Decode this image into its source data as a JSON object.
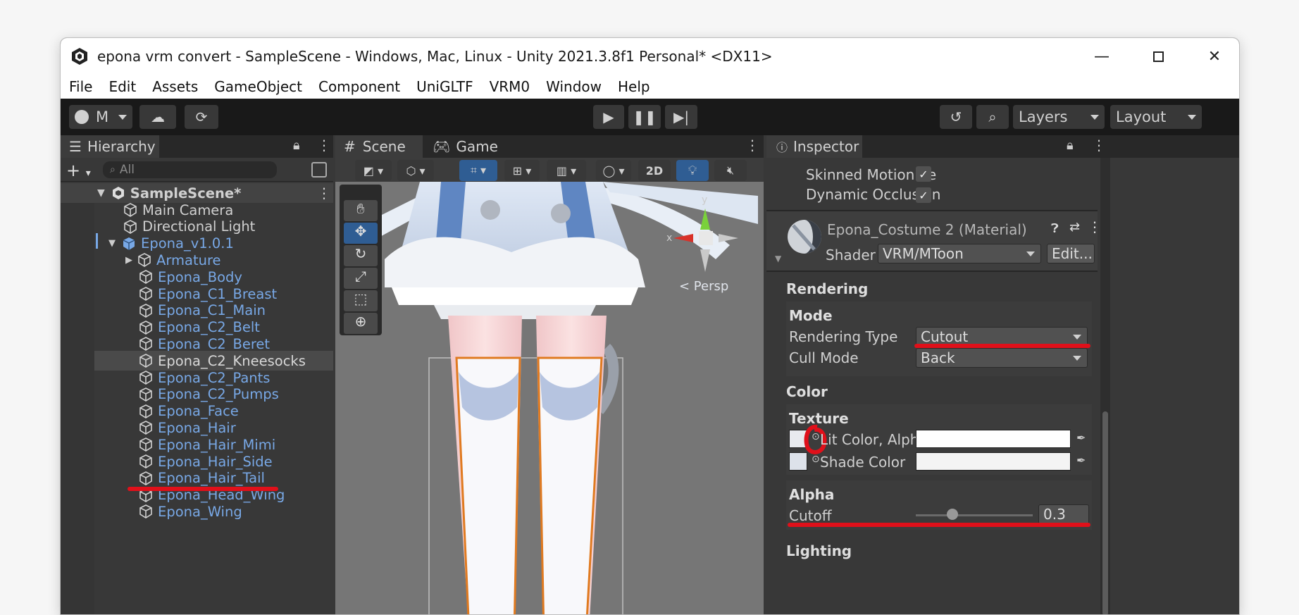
{
  "window": {
    "title": "epona vrm convert - SampleScene - Windows, Mac, Linux - Unity 2021.3.8f1 Personal* <DX11>"
  },
  "menu": [
    "File",
    "Edit",
    "Assets",
    "GameObject",
    "Component",
    "UniGLTF",
    "VRM0",
    "Window",
    "Help"
  ],
  "toolbar": {
    "account_label": "M",
    "layers_label": "Layers",
    "layout_label": "Layout"
  },
  "hierarchy": {
    "tab_label": "Hierarchy",
    "search_placeholder": "All",
    "scene_name": "SampleScene*",
    "items": [
      "Main Camera",
      "Directional Light",
      "Epona_v1.0.1",
      "Armature",
      "Epona_Body",
      "Epona_C1_Breast",
      "Epona_C1_Main",
      "Epona_C2_Belt",
      "Epona_C2_Beret",
      "Epona_C2_Kneesocks",
      "Epona_C2_Pants",
      "Epona_C2_Pumps",
      "Epona_Face",
      "Epona_Hair",
      "Epona_Hair_Mimi",
      "Epona_Hair_Side",
      "Epona_Hair_Tail",
      "Epona_Head_Wing",
      "Epona_Wing"
    ]
  },
  "scene": {
    "tab_scene": "Scene",
    "tab_game": "Game",
    "btn_2d": "2D",
    "persp_label": "< Persp",
    "gizmo_x": "x",
    "gizmo_y": "y"
  },
  "inspector": {
    "tab_label": "Inspector",
    "skinned_motion": "Skinned Motion Ve",
    "dynamic_occlusion": "Dynamic Occlusion",
    "material_name": "Epona_Costume 2 (Material)",
    "shader_label": "Shader",
    "shader_value": "VRM/MToon",
    "edit_button": "Edit...",
    "rendering_header": "Rendering",
    "mode_header": "Mode",
    "rendering_type_label": "Rendering Type",
    "rendering_type_value": "Cutout",
    "cull_mode_label": "Cull Mode",
    "cull_mode_value": "Back",
    "color_header": "Color",
    "texture_header": "Texture",
    "lit_color_label": "Lit Color, Alpha",
    "shade_color_label": "Shade Color",
    "alpha_header": "Alpha",
    "cutoff_label": "Cutoff",
    "cutoff_value": "0.3",
    "lighting_header": "Lighting"
  },
  "colors": {
    "accent_red": "#e0101a",
    "link_blue": "#78a8e6",
    "selection_blue": "#2f5d93"
  }
}
